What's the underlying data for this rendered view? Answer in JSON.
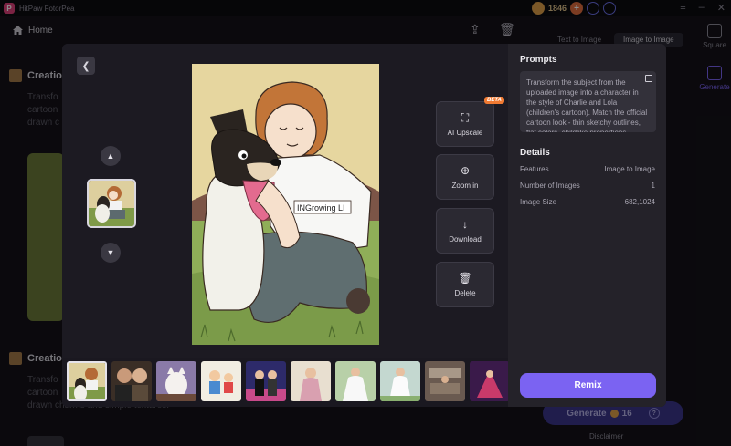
{
  "app": {
    "title": "HitPaw FotorPea",
    "credits": "1846"
  },
  "topbar": {
    "home_label": "Home",
    "tabs": [
      {
        "label": "Text to Image"
      },
      {
        "label": "Image to Image"
      }
    ],
    "right_tools": [
      {
        "label": "Square"
      },
      {
        "label": "Generate"
      }
    ]
  },
  "background": {
    "section_title": "Creatio",
    "text_lines": [
      "Transfo",
      "cartoon",
      "drawn c"
    ],
    "section_title_2": "Creatio",
    "text_lines_2": [
      "Transfo",
      "cartoon",
      "drawn charms and simple textures."
    ],
    "generate_label": "Generate",
    "generate_cost": "16",
    "disclaimer": "Disclaimer"
  },
  "modal": {
    "tools": [
      {
        "label": "AI Upscale",
        "icon": "upscale-icon"
      },
      {
        "label": "Zoom in",
        "icon": "zoom-in-icon"
      },
      {
        "label": "Download",
        "icon": "download-icon"
      },
      {
        "label": "Delete",
        "icon": "delete-icon"
      }
    ],
    "beta_badge": "BETA",
    "image_text": "INGrowing LI",
    "panel": {
      "prompts_heading": "Prompts",
      "prompt_text": "Transform the subject from the uploaded image into a character in the style of Charlie and Lola (children's cartoon). Match the official cartoon look - thin sketchy outlines, flat colors, childlike proportions",
      "details_heading": "Details",
      "details": [
        {
          "label": "Features",
          "value": "Image to Image"
        },
        {
          "label": "Number of Images",
          "value": "1"
        },
        {
          "label": "Image Size",
          "value": "682,1024"
        }
      ],
      "remix_label": "Remix"
    }
  },
  "colors": {
    "accent": "#7b63f2",
    "modal_bg": "#1e1c24",
    "panel_bg": "#242229"
  }
}
